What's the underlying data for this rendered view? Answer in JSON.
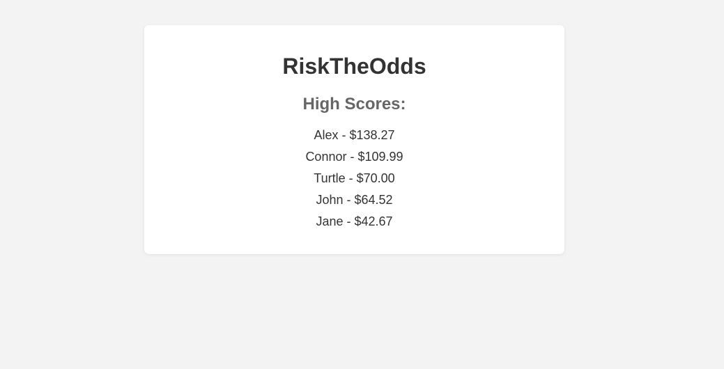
{
  "app": {
    "title": "RiskTheOdds"
  },
  "high_scores": {
    "heading": "High Scores:",
    "entries": [
      "Alex - $138.27",
      "Connor - $109.99",
      "Turtle - $70.00",
      "John - $64.52",
      "Jane - $42.67"
    ]
  }
}
